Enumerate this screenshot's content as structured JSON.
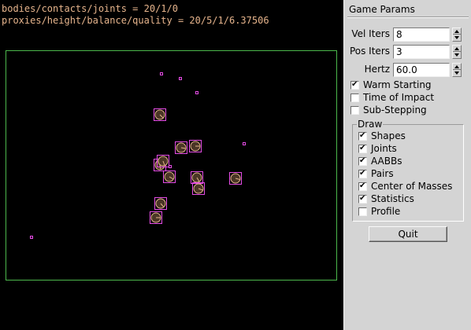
{
  "stats": {
    "line1": "bodies/contacts/joints = 20/1/0",
    "line2": "proxies/height/balance/quality = 20/5/1/6.37506"
  },
  "colors": {
    "background": "#000000",
    "stats_text": "#e6b48c",
    "boundary": "#4cb84c",
    "aabb": "#e64ce6",
    "shape_fill": "#4a3626",
    "shape_outline": "#e6b48c",
    "panel": "#d4d4d4"
  },
  "panel": {
    "title": "Game Params",
    "fields": [
      {
        "label": "Vel Iters",
        "value": "8"
      },
      {
        "label": "Pos Iters",
        "value": "3"
      },
      {
        "label": "Hertz",
        "value": "60.0"
      }
    ],
    "options": [
      {
        "label": "Warm Starting",
        "checked": true
      },
      {
        "label": "Time of Impact",
        "checked": false
      },
      {
        "label": "Sub-Stepping",
        "checked": false
      }
    ],
    "draw_group": {
      "title": "Draw",
      "items": [
        {
          "label": "Shapes",
          "checked": true
        },
        {
          "label": "Joints",
          "checked": true
        },
        {
          "label": "AABBs",
          "checked": true
        },
        {
          "label": "Pairs",
          "checked": true
        },
        {
          "label": "Center of Masses",
          "checked": true
        },
        {
          "label": "Statistics",
          "checked": true
        },
        {
          "label": "Profile",
          "checked": false
        }
      ]
    },
    "quit_label": "Quit"
  },
  "scene": {
    "bodies": [
      {
        "kind": "box",
        "angle": 45
      },
      {
        "kind": "box",
        "angle": 0
      },
      {
        "kind": "box",
        "angle": 10
      },
      {
        "kind": "box",
        "angle": 80
      },
      {
        "kind": "box",
        "angle": 30
      },
      {
        "kind": "box",
        "angle": 60
      },
      {
        "kind": "box",
        "angle": 20
      },
      {
        "kind": "box",
        "angle": 15
      },
      {
        "kind": "box",
        "angle": 50
      },
      {
        "kind": "box",
        "angle": 0
      },
      {
        "kind": "box",
        "angle": 70
      },
      {
        "kind": "particle"
      },
      {
        "kind": "particle"
      },
      {
        "kind": "particle"
      },
      {
        "kind": "particle"
      },
      {
        "kind": "particle"
      },
      {
        "kind": "particle"
      },
      {
        "kind": "particle"
      }
    ]
  }
}
